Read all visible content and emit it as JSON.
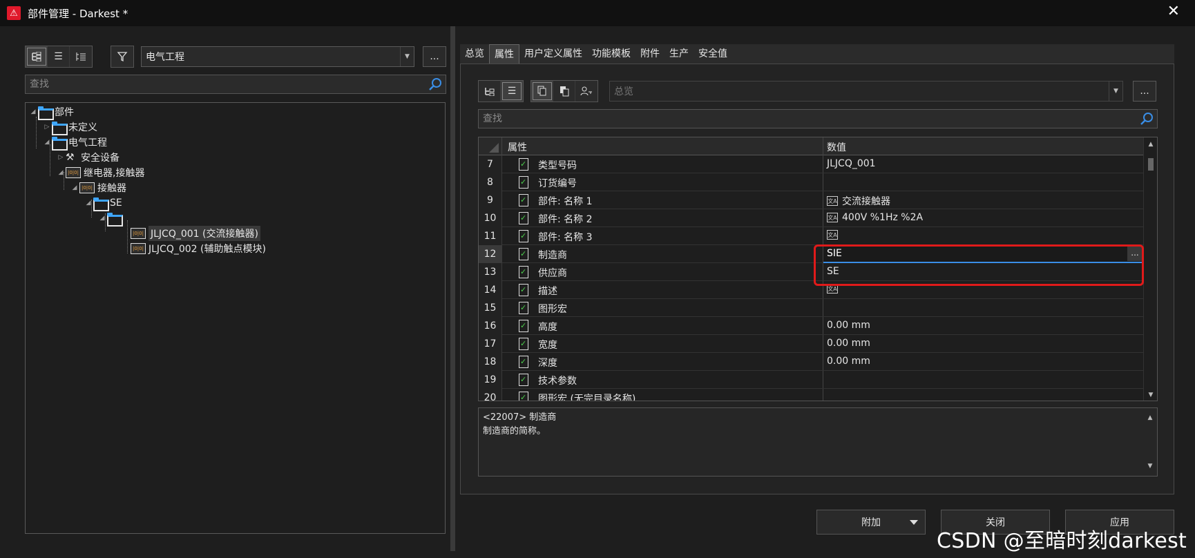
{
  "window": {
    "title": "部件管理 - Darkest *",
    "close_label": "✕"
  },
  "left": {
    "filter_value": "电气工程",
    "more_label": "...",
    "search_placeholder": "查找",
    "tree": [
      {
        "label": "部件"
      },
      {
        "label": "未定义"
      },
      {
        "label": "电气工程"
      },
      {
        "label": "安全设备"
      },
      {
        "label": "继电器,接触器"
      },
      {
        "label": "接触器"
      },
      {
        "label": "SE"
      },
      {
        "label": ""
      },
      {
        "label": "JLJCQ_001 (交流接触器)"
      },
      {
        "label": "JLJCQ_002 (辅助触点模块)"
      }
    ]
  },
  "right": {
    "tabs": [
      "总览",
      "属性",
      "用户定义属性",
      "功能模板",
      "附件",
      "生产",
      "安全值"
    ],
    "active_tab": "属性",
    "view_combo": "总览",
    "more_label": "...",
    "search_placeholder": "查找",
    "grid_headers": {
      "property": "属性",
      "value": "数值"
    },
    "rows": [
      {
        "num": "7",
        "name": "类型号码",
        "value": "JLJCQ_001",
        "lang": false
      },
      {
        "num": "8",
        "name": "订货编号",
        "value": "",
        "lang": false
      },
      {
        "num": "9",
        "name": "部件: 名称 1",
        "value": "交流接触器",
        "lang": true
      },
      {
        "num": "10",
        "name": "部件: 名称 2",
        "value": "400V %1Hz %2A",
        "lang": true
      },
      {
        "num": "11",
        "name": "部件: 名称 3",
        "value": "",
        "lang": true
      },
      {
        "num": "12",
        "name": "制造商",
        "value": "SIE",
        "lang": false,
        "editing": true
      },
      {
        "num": "13",
        "name": "供应商",
        "value": "SE",
        "lang": false
      },
      {
        "num": "14",
        "name": "描述",
        "value": "",
        "lang": true
      },
      {
        "num": "15",
        "name": "图形宏",
        "value": "",
        "lang": false
      },
      {
        "num": "16",
        "name": "高度",
        "value": "0.00 mm",
        "lang": false
      },
      {
        "num": "17",
        "name": "宽度",
        "value": "0.00 mm",
        "lang": false
      },
      {
        "num": "18",
        "name": "深度",
        "value": "0.00 mm",
        "lang": false
      },
      {
        "num": "19",
        "name": "技术参数",
        "value": "",
        "lang": false
      },
      {
        "num": "20",
        "name": "图形宏 (无完目录名称)",
        "value": "",
        "lang": false
      }
    ],
    "description": {
      "line1": "<22007> 制造商",
      "line2": "制造商的简称。"
    }
  },
  "buttons": {
    "add": "附加",
    "close": "关闭",
    "apply": "应用"
  },
  "watermark": "CSDN @至暗时刻darkest",
  "colors": {
    "highlight": "#e01a1a",
    "accent_blue": "#3ea6ff",
    "check_green": "#4cd04c"
  }
}
